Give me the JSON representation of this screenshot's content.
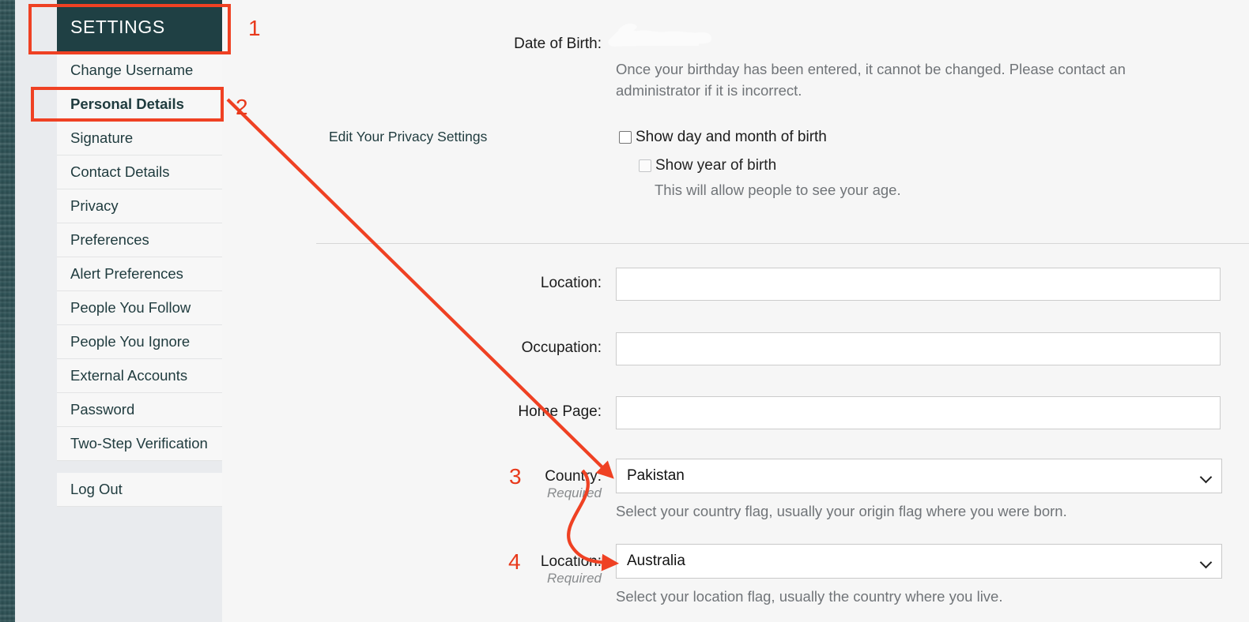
{
  "sidebar": {
    "header": "SETTINGS",
    "items": [
      {
        "label": "Change Username",
        "active": false
      },
      {
        "label": "Personal Details",
        "active": true
      },
      {
        "label": "Signature",
        "active": false
      },
      {
        "label": "Contact Details",
        "active": false
      },
      {
        "label": "Privacy",
        "active": false
      },
      {
        "label": "Preferences",
        "active": false
      },
      {
        "label": "Alert Preferences",
        "active": false
      },
      {
        "label": "People You Follow",
        "active": false
      },
      {
        "label": "People You Ignore",
        "active": false
      },
      {
        "label": "External Accounts",
        "active": false
      },
      {
        "label": "Password",
        "active": false
      },
      {
        "label": "Two-Step Verification",
        "active": false
      }
    ],
    "logout": "Log Out"
  },
  "main": {
    "dob": {
      "label": "Date of Birth:",
      "value": "",
      "note": "Once your birthday has been entered, it cannot be changed. Please contact an administrator if it is incorrect."
    },
    "privacy": {
      "label": "Edit Your Privacy Settings",
      "show_day_month": "Show day and month of birth",
      "show_year": "Show year of birth",
      "show_year_note": "This will allow people to see your age."
    },
    "fields": [
      {
        "label": "Location:",
        "value": "",
        "placeholder": ""
      },
      {
        "label": "Occupation:",
        "value": "",
        "placeholder": ""
      },
      {
        "label": "Home Page:",
        "value": "",
        "placeholder": ""
      }
    ],
    "country": {
      "label": "Country:",
      "required": "Required",
      "value": "Pakistan",
      "helper": "Select your country flag, usually your origin flag where you were born."
    },
    "location": {
      "label": "Location:",
      "required": "Required",
      "value": "Australia",
      "helper": "Select your location flag, usually the country where you live."
    }
  },
  "annotations": {
    "numbers": [
      "1",
      "2",
      "3",
      "4"
    ],
    "color": "#ef4123"
  }
}
